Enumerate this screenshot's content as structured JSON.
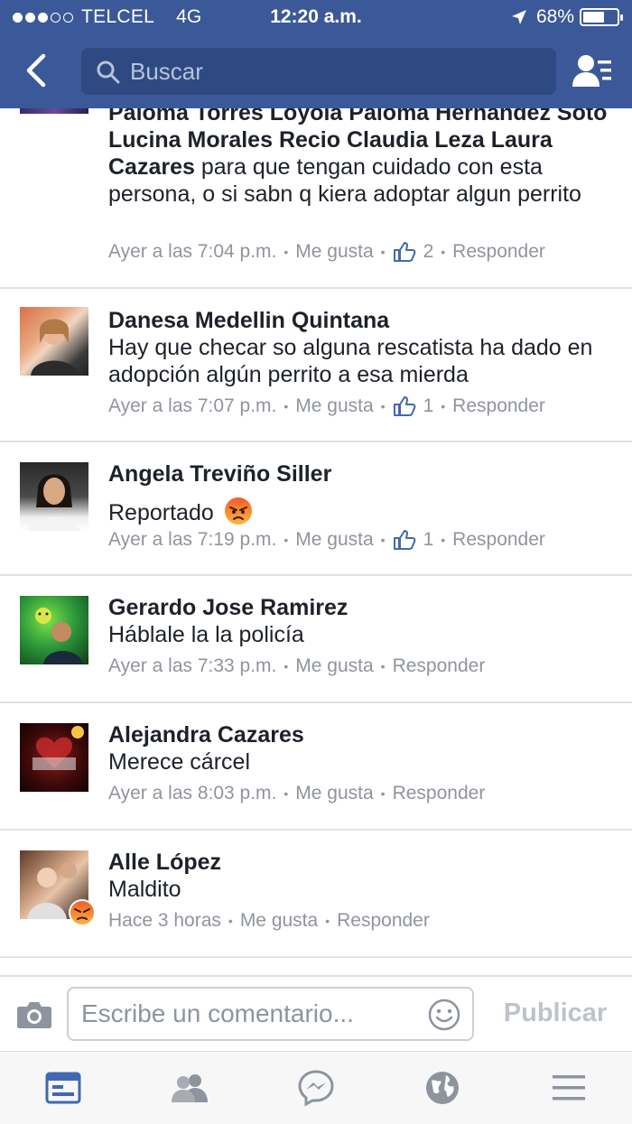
{
  "status_bar": {
    "carrier": "TELCEL",
    "network": "4G",
    "time": "12:20 a.m.",
    "battery": "68%",
    "battery_level": 0.68
  },
  "header": {
    "search_placeholder": "Buscar"
  },
  "comments": [
    {
      "name": "",
      "body_names": "Paloma Torres Loyola Paloma Hernandez Soto Lucina Morales Recio Claudia Leza Laura Cazares",
      "body": " para que tengan cuidado con esta persona, o si sabn q kiera adoptar algun perrito",
      "time": "Ayer a las 7:04 p.m.",
      "like": "Me gusta",
      "likes": "2",
      "reply": "Responder"
    },
    {
      "name": "Danesa Medellin Quintana",
      "body": "Hay que checar so alguna rescatista ha dado en adopción algún perrito a esa mierda",
      "time": "Ayer a las 7:07 p.m.",
      "like": "Me gusta",
      "likes": "1",
      "reply": "Responder"
    },
    {
      "name": "Angela Treviño Siller",
      "body": "Reportado",
      "time": "Ayer a las 7:19 p.m.",
      "like": "Me gusta",
      "likes": "1",
      "reply": "Responder"
    },
    {
      "name": "Gerardo Jose Ramirez",
      "body": "Háblale la la policía",
      "time": "Ayer a las 7:33 p.m.",
      "like": "Me gusta",
      "reply": "Responder"
    },
    {
      "name": "Alejandra Cazares",
      "body": "Merece cárcel",
      "time": "Ayer a las 8:03 p.m.",
      "like": "Me gusta",
      "reply": "Responder"
    },
    {
      "name": "Alle López",
      "body": "Maldito",
      "time": "Hace 3 horas",
      "like": "Me gusta",
      "reply": "Responder"
    }
  ],
  "composer": {
    "placeholder": "Escribe un comentario...",
    "publish": "Publicar"
  },
  "tabs": [
    {
      "icon": "news-feed-icon",
      "active": true
    },
    {
      "icon": "friend-requests-icon",
      "active": false
    },
    {
      "icon": "messenger-icon",
      "active": false
    },
    {
      "icon": "notifications-globe-icon",
      "active": false
    },
    {
      "icon": "menu-icon",
      "active": false
    }
  ],
  "colors": {
    "brand": "#3b5998",
    "like_blue": "#4267b2",
    "meta_gray": "#90949c",
    "divider": "#e1e2e5"
  }
}
